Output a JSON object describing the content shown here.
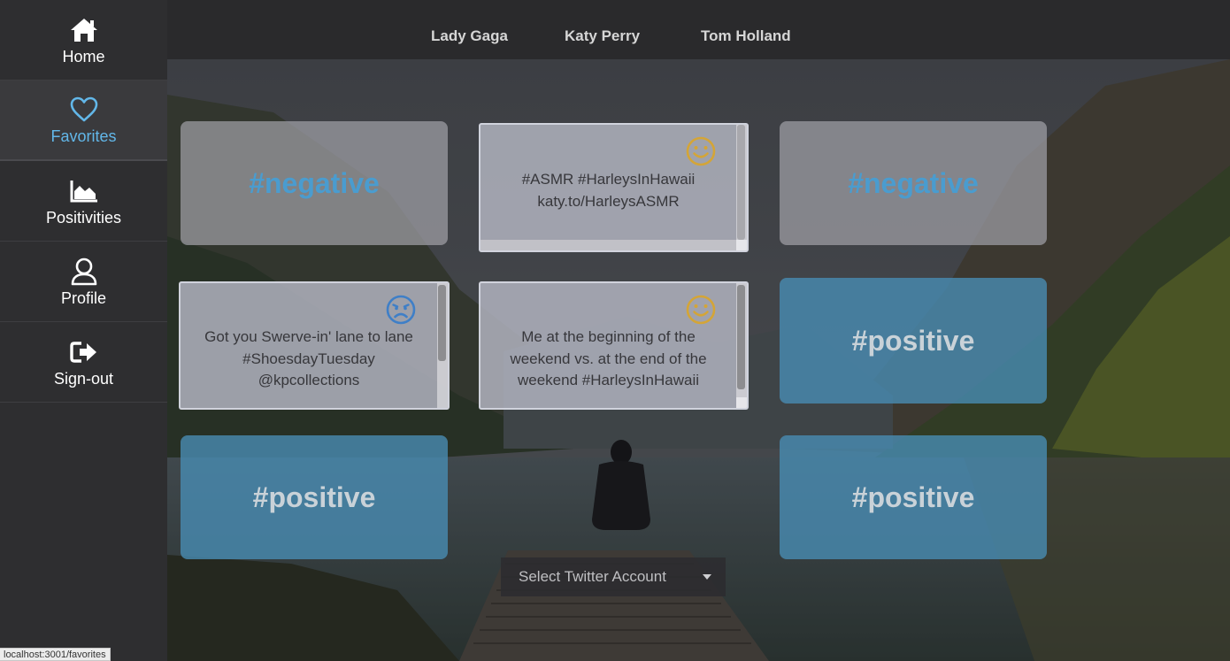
{
  "sidebar": {
    "items": [
      {
        "label": "Home",
        "icon": "home-icon",
        "active": false
      },
      {
        "label": "Favorites",
        "icon": "heart-icon",
        "active": true
      },
      {
        "label": "Positivities",
        "icon": "area-chart-icon",
        "active": false
      },
      {
        "label": "Profile",
        "icon": "user-icon",
        "active": false
      },
      {
        "label": "Sign-out",
        "icon": "sign-out-icon",
        "active": false
      }
    ]
  },
  "topbar": {
    "links": [
      "Lady Gaga",
      "Katy Perry",
      "Tom Holland"
    ]
  },
  "cards": {
    "c1": "#negative",
    "c3": "#negative",
    "c6": "#positive",
    "c7": "#positive",
    "c9": "#positive",
    "t1": {
      "line1": "#ASMR #HarleysInHawaii",
      "line2": "katy.to/HarleysASMR",
      "sentiment": "happy-face-icon"
    },
    "t2": {
      "line1": "Got you Swerve-in' lane to lane",
      "line2": "#ShoesdayTuesday",
      "line3": "@kpcollections",
      "sentiment": "sad-face-icon"
    },
    "t3": {
      "line1": "Me at the beginning of the",
      "line2": "weekend vs. at the end of the",
      "line3": "weekend #HarleysInHawaii",
      "sentiment": "happy-face-icon"
    }
  },
  "colors": {
    "accent": "#62b7e9",
    "negative_hashtag": "#4a9ccf",
    "happy": "#d4a537",
    "sad": "#3f7fc7"
  },
  "select": {
    "placeholder": "Select Twitter Account"
  },
  "status": {
    "url": "localhost:3001/favorites"
  }
}
